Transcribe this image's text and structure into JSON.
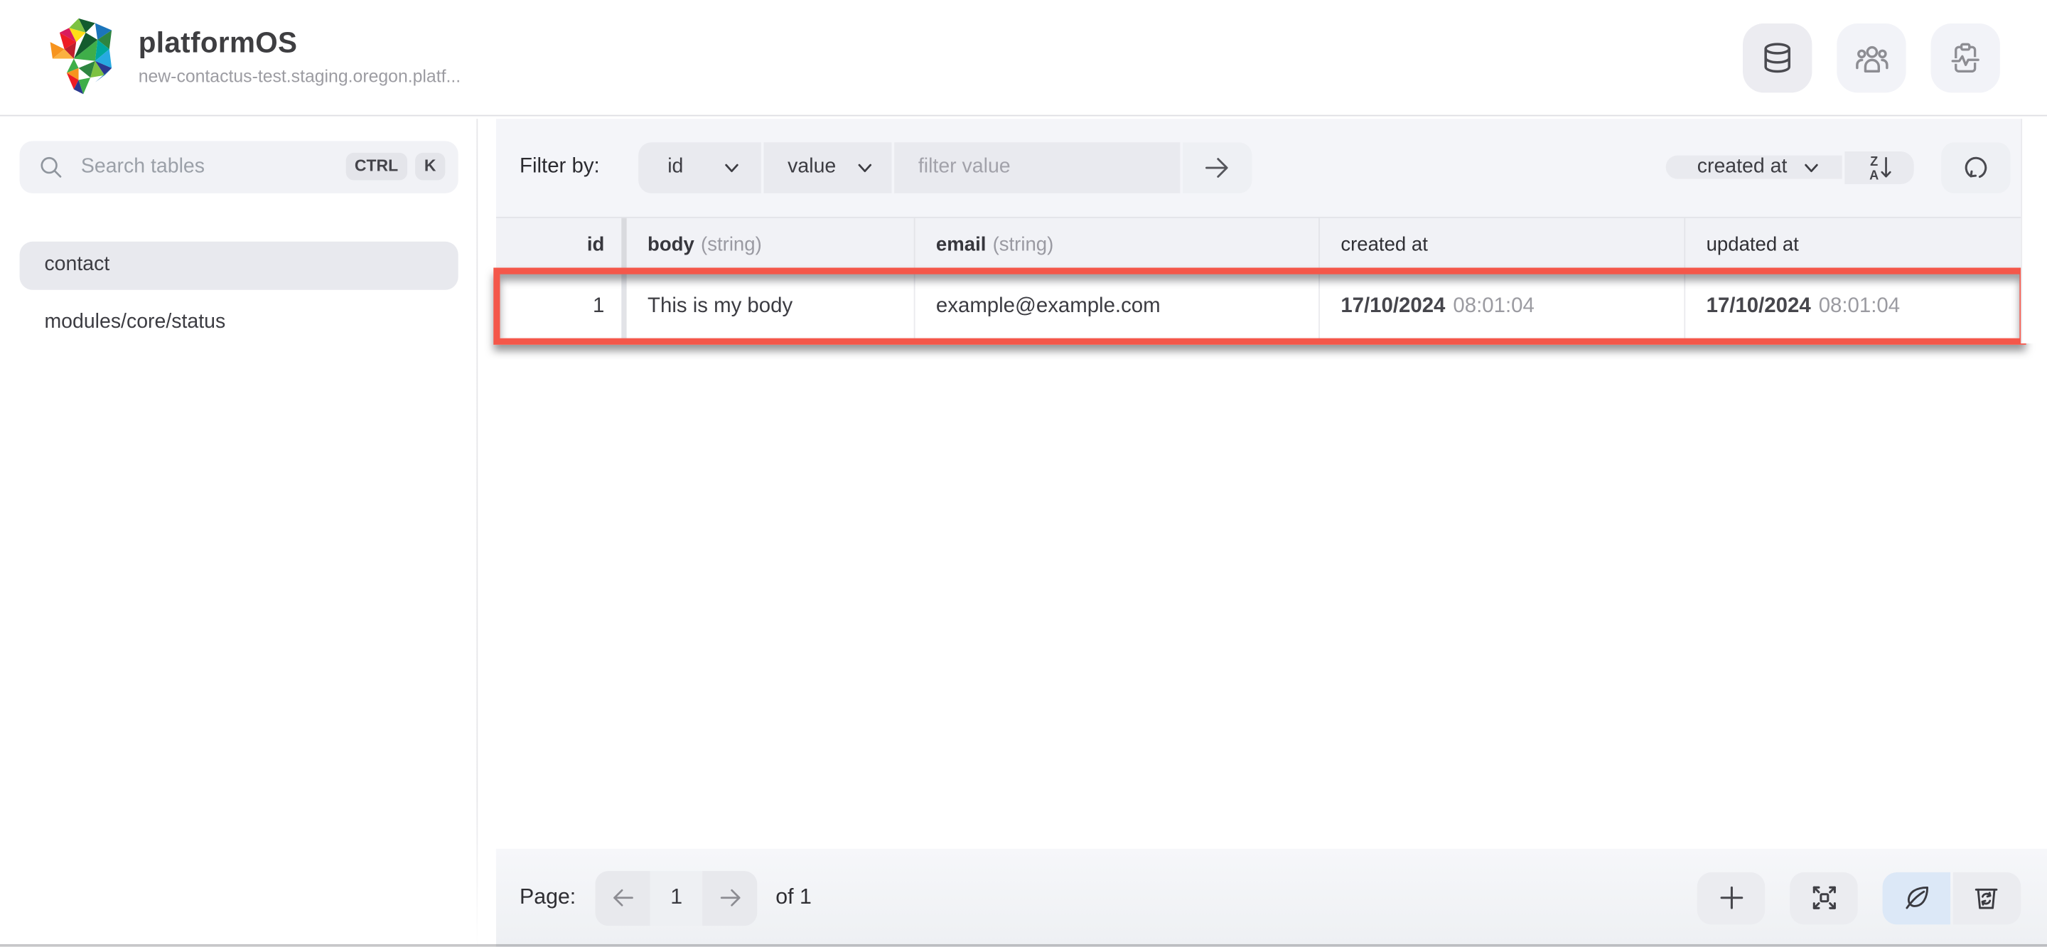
{
  "header": {
    "app_name": "platformOS",
    "instance_domain": "new-contactus-test.staging.oregon.platf..."
  },
  "sidebar": {
    "search": {
      "placeholder": "Search tables",
      "shortcut_key_1": "CTRL",
      "shortcut_key_2": "K"
    },
    "tables": [
      {
        "label": "contact",
        "selected": true
      },
      {
        "label": "modules/core/status",
        "selected": false
      }
    ]
  },
  "filter_bar": {
    "label": "Filter by:",
    "field_selected": "id",
    "operator_selected": "value",
    "value_placeholder": "filter value",
    "sort_field_selected": "created at"
  },
  "table": {
    "columns": [
      {
        "label": "id",
        "type": ""
      },
      {
        "label": "body",
        "type": "(string)"
      },
      {
        "label": "email",
        "type": "(string)"
      },
      {
        "label": "created at",
        "type": ""
      },
      {
        "label": "updated at",
        "type": ""
      }
    ],
    "rows": [
      {
        "id": "1",
        "body": "This is my body",
        "email": "example@example.com",
        "created_date": "17/10/2024",
        "created_time": "08:01:04",
        "updated_date": "17/10/2024",
        "updated_time": "08:01:04",
        "highlighted": true
      }
    ]
  },
  "footer": {
    "page_label": "Page:",
    "current_page": "1",
    "of_label": "of 1"
  },
  "colors": {
    "highlight_border": "#f4574a",
    "active_toggle_bg": "#dce8f7",
    "selected_item_bg": "#e8e9ee",
    "control_bg": "#e9eaef",
    "strip_bg": "#f4f5f9"
  }
}
